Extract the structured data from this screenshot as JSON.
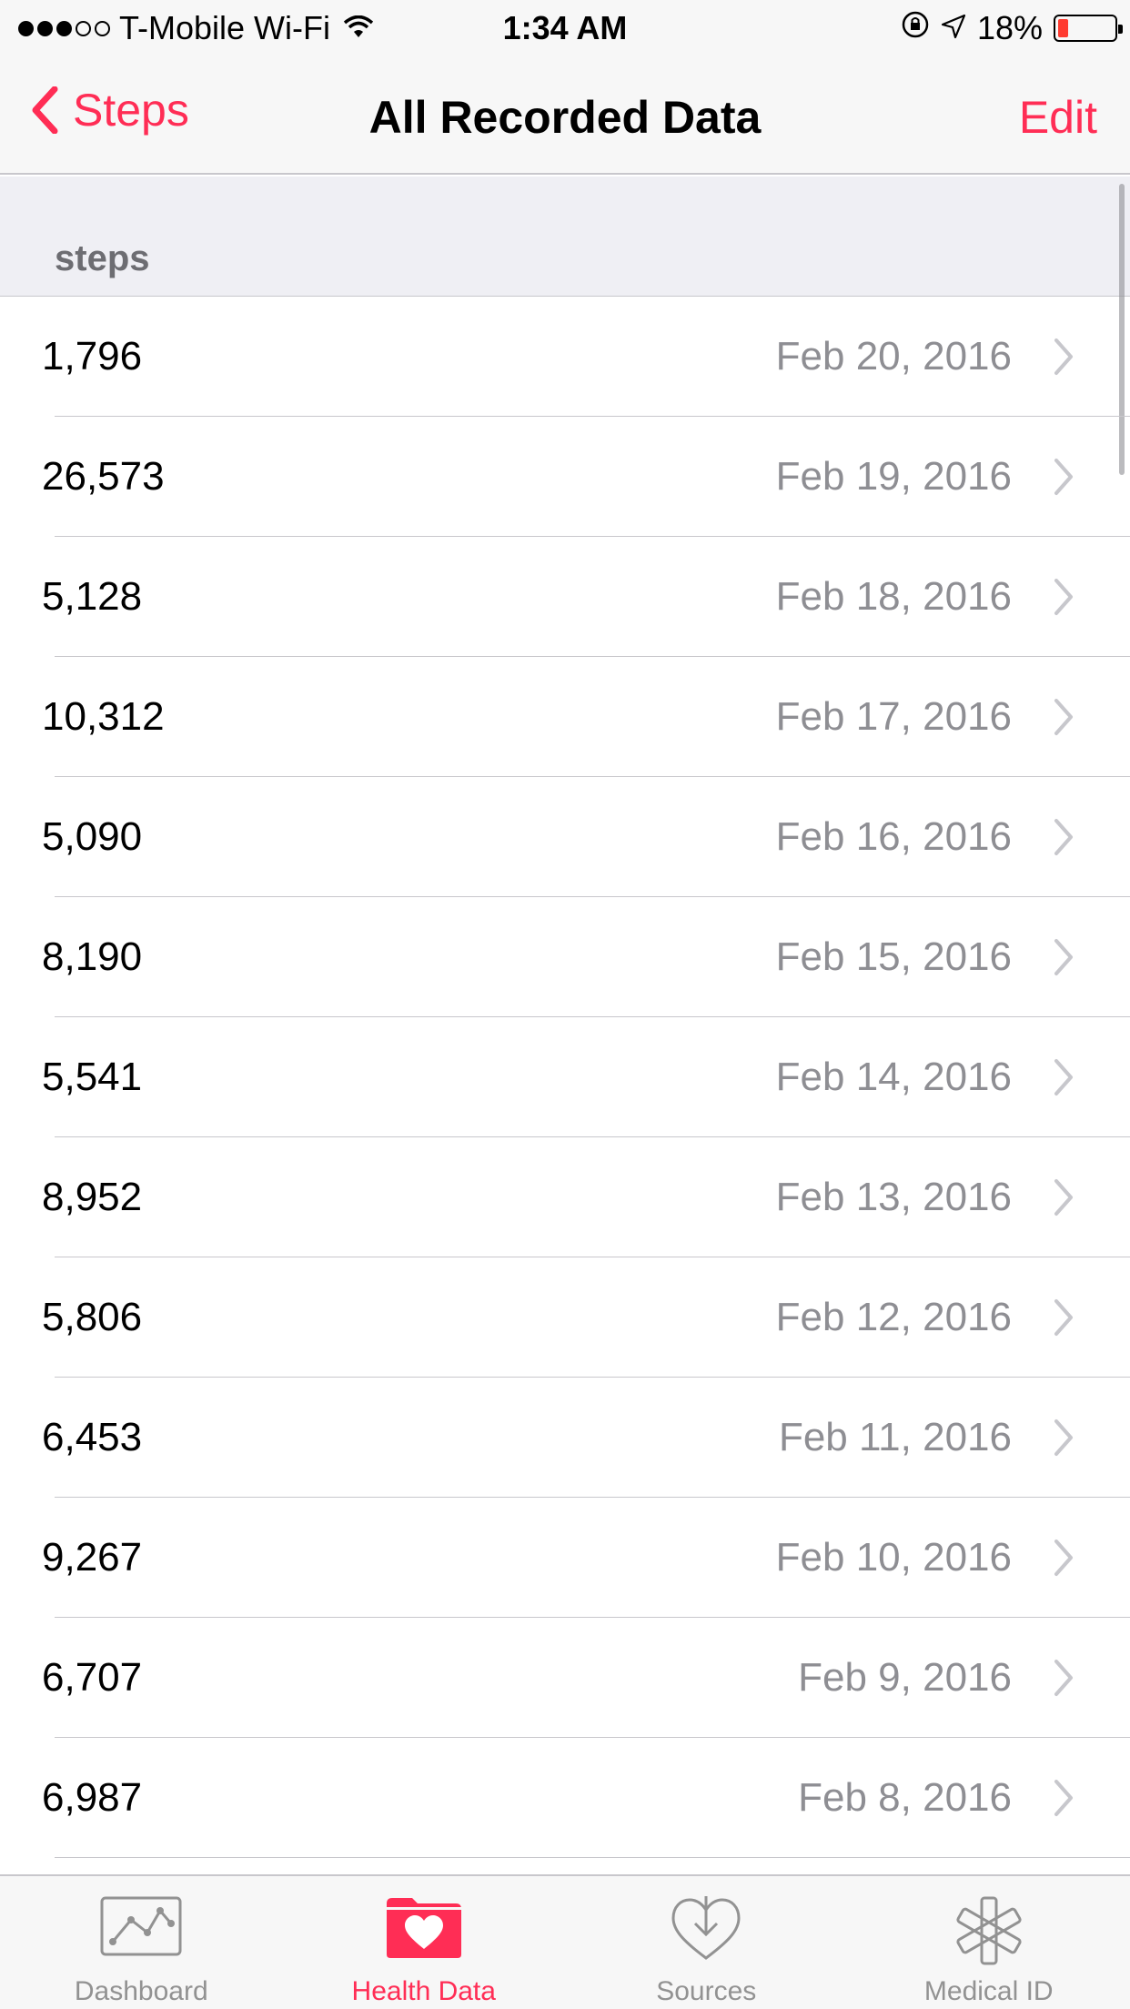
{
  "status_bar": {
    "carrier": "T-Mobile Wi-Fi",
    "time": "1:34 AM",
    "battery": "18%",
    "signal_bars_filled": 3,
    "signal_bars_total": 5,
    "battery_level": 0.18
  },
  "nav": {
    "back_label": "Steps",
    "title": "All Recorded Data",
    "edit_label": "Edit"
  },
  "section": {
    "header": "steps"
  },
  "rows": [
    {
      "value": "1,796",
      "date": "Feb 20, 2016"
    },
    {
      "value": "26,573",
      "date": "Feb 19, 2016"
    },
    {
      "value": "5,128",
      "date": "Feb 18, 2016"
    },
    {
      "value": "10,312",
      "date": "Feb 17, 2016"
    },
    {
      "value": "5,090",
      "date": "Feb 16, 2016"
    },
    {
      "value": "8,190",
      "date": "Feb 15, 2016"
    },
    {
      "value": "5,541",
      "date": "Feb 14, 2016"
    },
    {
      "value": "8,952",
      "date": "Feb 13, 2016"
    },
    {
      "value": "5,806",
      "date": "Feb 12, 2016"
    },
    {
      "value": "6,453",
      "date": "Feb 11, 2016"
    },
    {
      "value": "9,267",
      "date": "Feb 10, 2016"
    },
    {
      "value": "6,707",
      "date": "Feb 9, 2016"
    },
    {
      "value": "6,987",
      "date": "Feb 8, 2016"
    }
  ],
  "tabs": [
    {
      "label": "Dashboard",
      "icon": "dashboard-chart-icon",
      "active": false
    },
    {
      "label": "Health Data",
      "icon": "health-data-folder-icon",
      "active": true
    },
    {
      "label": "Sources",
      "icon": "sources-download-heart-icon",
      "active": false
    },
    {
      "label": "Medical ID",
      "icon": "medical-id-asterisk-icon",
      "active": false
    }
  ],
  "colors": {
    "accent": "#ff2d55",
    "secondary_text": "#8e8e93",
    "section_bg": "#efeff4",
    "separator": "#c8c7cc"
  }
}
